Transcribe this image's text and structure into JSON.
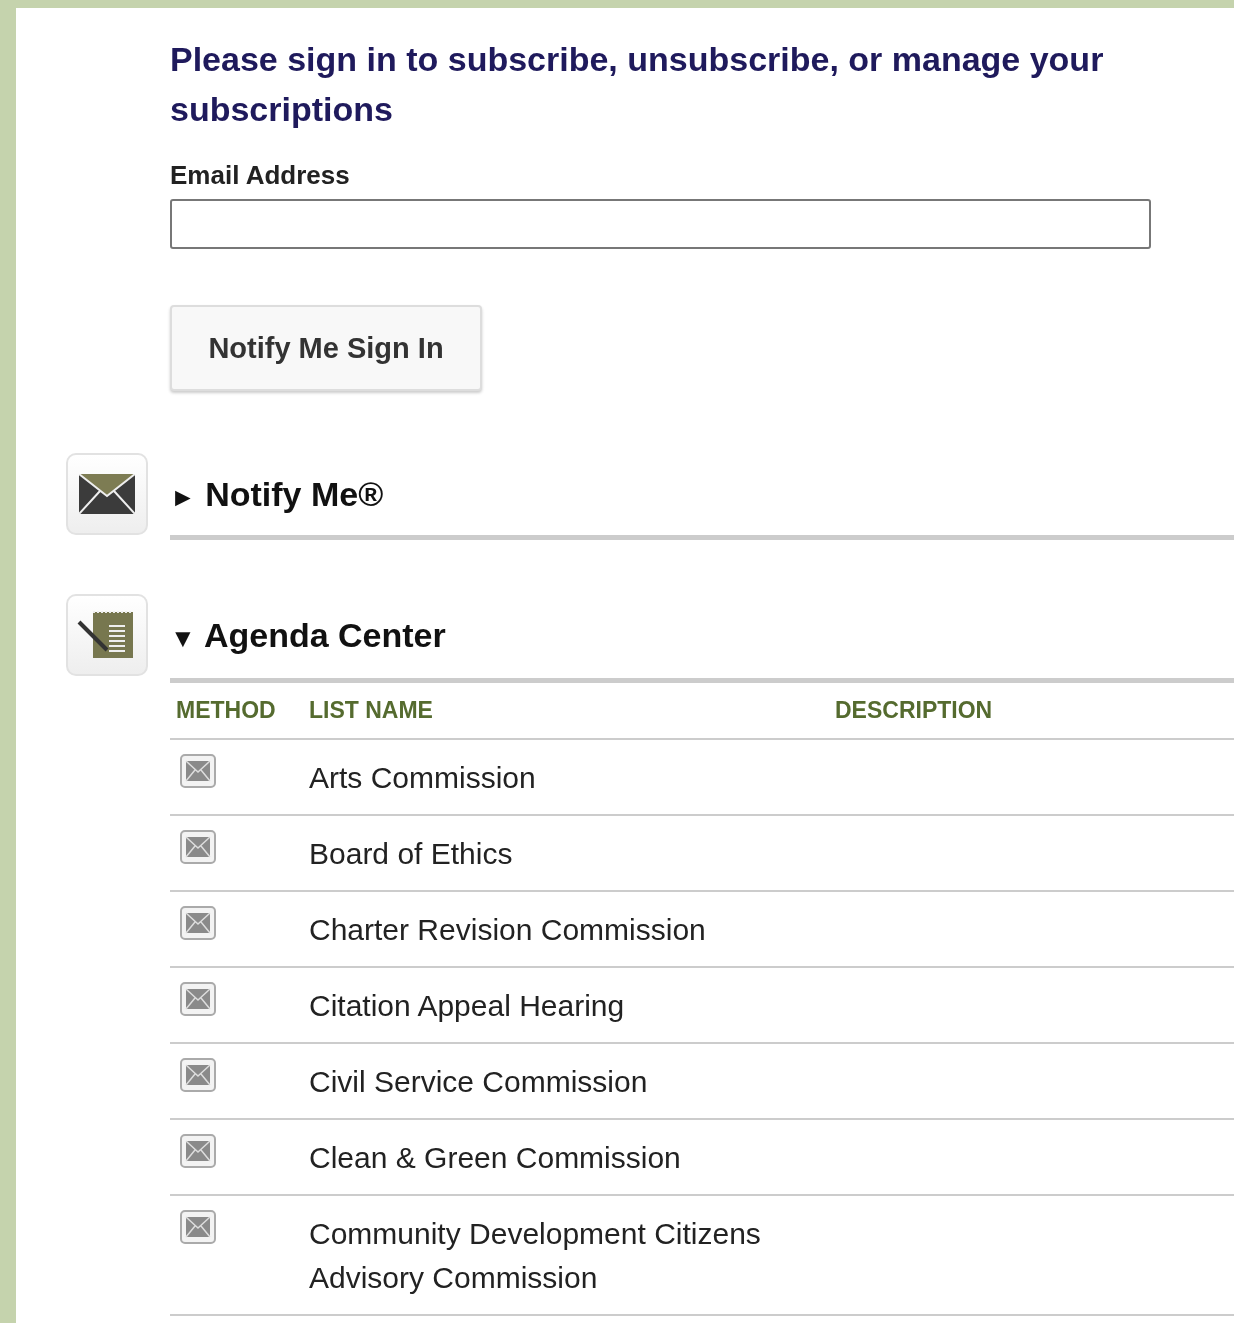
{
  "heading": "Please sign in to subscribe, unsubscribe, or manage your subscriptions",
  "email_field": {
    "label": "Email Address"
  },
  "sign_in_button": "Notify Me Sign In",
  "sections": [
    {
      "kind": "mail",
      "toggle": "►",
      "title": "Notify Me®"
    },
    {
      "kind": "agenda",
      "toggle": "▼",
      "title": "Agenda Center",
      "table": {
        "columns": [
          "METHOD",
          "LIST NAME",
          "DESCRIPTION"
        ],
        "rows": [
          {
            "list_name": "Arts Commission"
          },
          {
            "list_name": "Board of Ethics"
          },
          {
            "list_name": "Charter Revision Commission"
          },
          {
            "list_name": "Citation Appeal Hearing"
          },
          {
            "list_name": "Civil Service Commission"
          },
          {
            "list_name": "Clean & Green Commission"
          },
          {
            "list_name": "Community Development Citizens Advisory Commission"
          }
        ]
      }
    }
  ]
}
